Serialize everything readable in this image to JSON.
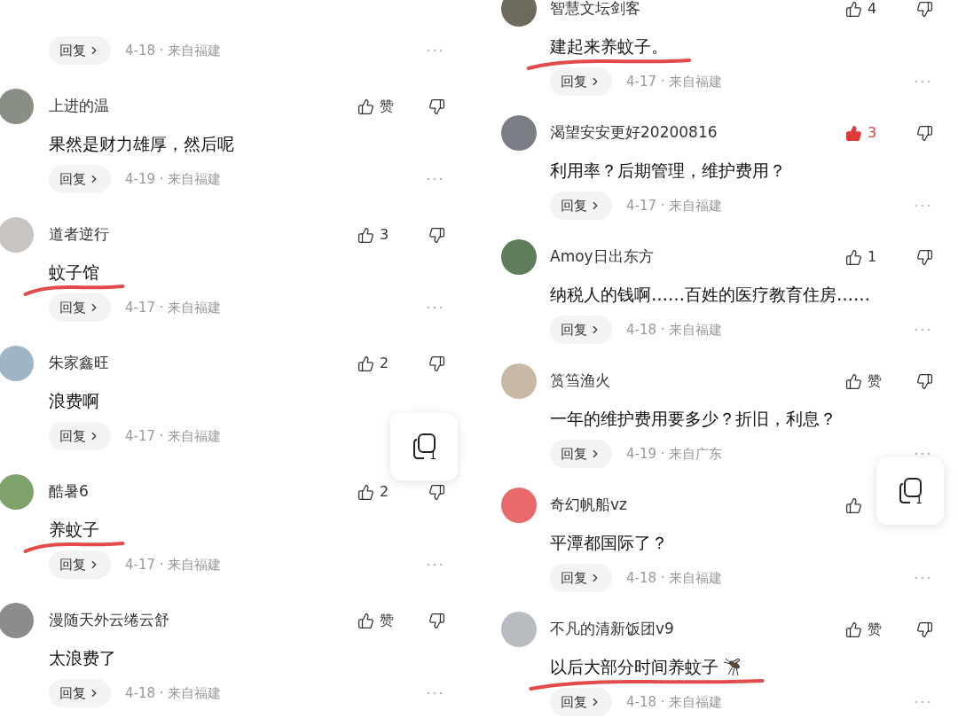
{
  "panels": [
    {
      "floating_badge": "1",
      "comments": [
        {
          "reply": "回复",
          "meta": "4-18 · 来自福建"
        },
        {
          "name": "上进的温",
          "like": "赞",
          "liked": false,
          "text": "果然是财力雄厚，然后呢",
          "underlined": false,
          "reply": "回复",
          "meta": "4-19 · 来自福建"
        },
        {
          "name": "道者逆行",
          "like": "3",
          "liked": false,
          "text": "蚊子馆",
          "underlined": true,
          "reply": "回复",
          "meta": "4-17 · 来自福建"
        },
        {
          "name": "朱家鑫旺",
          "like": "2",
          "liked": false,
          "text": "浪费啊",
          "underlined": false,
          "reply": "回复",
          "meta": "4-17 · 来自福建"
        },
        {
          "name": "酷暑6",
          "like": "2",
          "liked": false,
          "text": "养蚊子",
          "underlined": true,
          "reply": "回复",
          "meta": "4-17 · 来自福建"
        },
        {
          "name": "漫随天外云绻云舒",
          "like": "赞",
          "liked": false,
          "text": "太浪费了",
          "underlined": false,
          "reply": "回复",
          "meta": "4-18 · 来自福建"
        }
      ]
    },
    {
      "floating_badge": "1",
      "comments": [
        {
          "name": "智慧文坛剑客",
          "like": "4",
          "liked": false,
          "text": "建起来养蚊子。",
          "underlined": true,
          "reply": "回复",
          "meta": "4-17 · 来自福建"
        },
        {
          "name": "渴望安安更好20200816",
          "like": "3",
          "liked": true,
          "text": "利用率？后期管理，维护费用？",
          "underlined": false,
          "reply": "回复",
          "meta": "4-17 · 来自福建"
        },
        {
          "name": "Amoy日出东方",
          "like": "1",
          "liked": false,
          "text": "纳税人的钱啊……百姓的医疗教育住房……",
          "underlined": false,
          "reply": "回复",
          "meta": "4-18 · 来自福建"
        },
        {
          "name": "筼筜渔火",
          "like": "赞",
          "liked": false,
          "text": "一年的维护费用要多少？折旧，利息？",
          "underlined": false,
          "reply": "回复",
          "meta": "4-19 · 来自广东"
        },
        {
          "name": "奇幻帆船vz",
          "liked": false,
          "text": "平潭都国际了？",
          "underlined": false,
          "reply": "回复",
          "meta": "4-18 · 来自福建"
        },
        {
          "name": "不凡的清新饭团v9",
          "like": "赞",
          "liked": false,
          "text": "以后大部分时间养蚊子",
          "mosquito_icon": true,
          "underlined": true,
          "reply": "回复",
          "meta": "4-18 · 来自福建"
        }
      ]
    }
  ]
}
